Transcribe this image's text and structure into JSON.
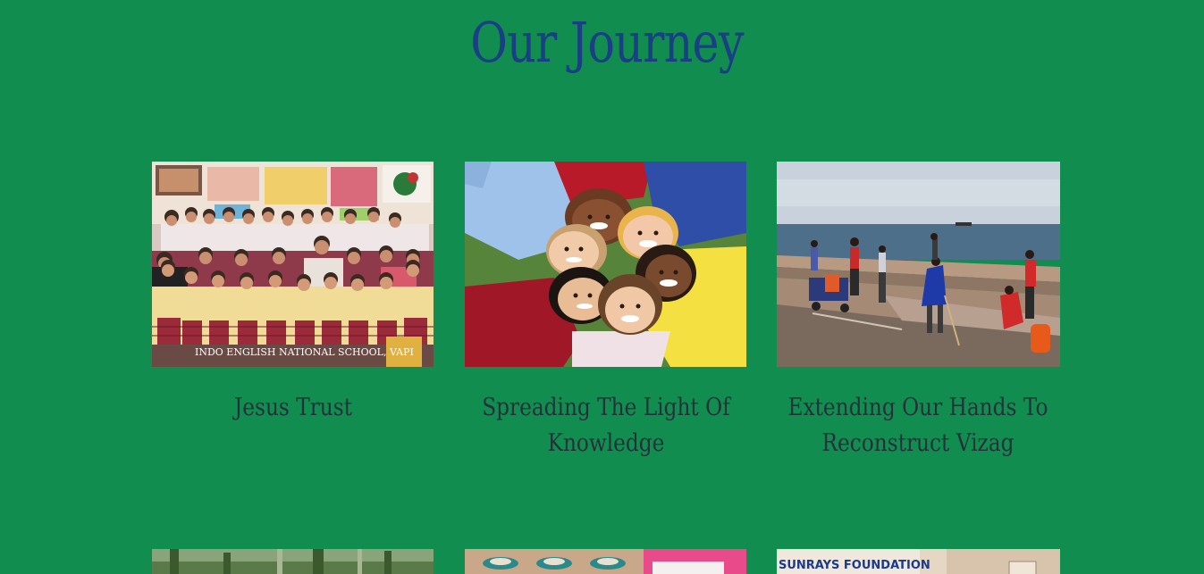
{
  "page": {
    "title": "Our Journey"
  },
  "cards": [
    {
      "title": "Jesus Trust",
      "photo_caption": "INDO ENGLISH NATIONAL SCHOOL, VAPI"
    },
    {
      "title": "Spreading The Light Of Knowledge"
    },
    {
      "title": "Extending Our Hands To Reconstruct Vizag"
    }
  ],
  "bottom_cards": [
    {},
    {},
    {
      "banner_text": "SUNRAYS FOUNDATION"
    }
  ],
  "colors": {
    "background": "#128d50",
    "title": "#1a3f85",
    "card_title": "#25313a"
  }
}
